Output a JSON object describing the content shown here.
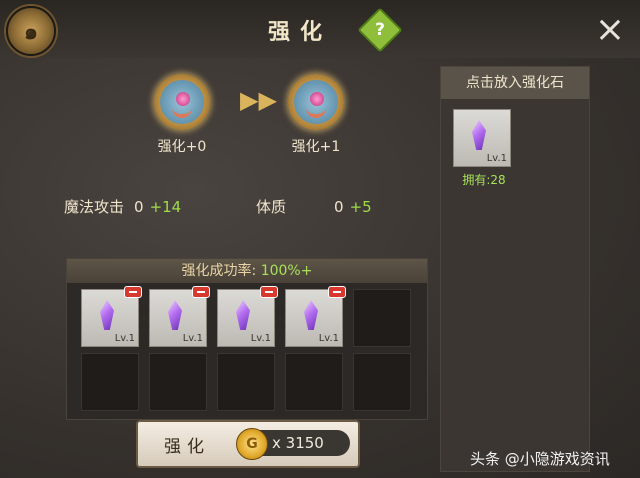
{
  "header": {
    "title": "强化",
    "help_icon": "?",
    "close_icon": "×"
  },
  "enhance_target": {
    "current_level_label": "强化+0",
    "next_level_label": "强化+1"
  },
  "stats": [
    {
      "name": "魔法攻击",
      "base": "0",
      "bonus": "+14"
    },
    {
      "name": "体质",
      "base": "0",
      "bonus": "+5"
    }
  ],
  "success": {
    "label": "强化成功率:",
    "rate": "100%+"
  },
  "material_slots": [
    {
      "filled": true,
      "level": "Lv.1"
    },
    {
      "filled": true,
      "level": "Lv.1"
    },
    {
      "filled": true,
      "level": "Lv.1"
    },
    {
      "filled": true,
      "level": "Lv.1"
    },
    {
      "filled": false,
      "level": ""
    },
    {
      "filled": false,
      "level": ""
    },
    {
      "filled": false,
      "level": ""
    },
    {
      "filled": false,
      "level": ""
    },
    {
      "filled": false,
      "level": ""
    },
    {
      "filled": false,
      "level": ""
    }
  ],
  "enhance_button": {
    "label": "强化",
    "cost": "x 3150"
  },
  "side_panel": {
    "title": "点击放入强化石",
    "item_level": "Lv.1",
    "owned": "拥有:28"
  },
  "watermark": "头条 @小隐游戏资讯",
  "colors": {
    "bonus_green": "#9fdc4a",
    "help_green": "#8fbf3a",
    "remove_red": "#d8392f"
  }
}
